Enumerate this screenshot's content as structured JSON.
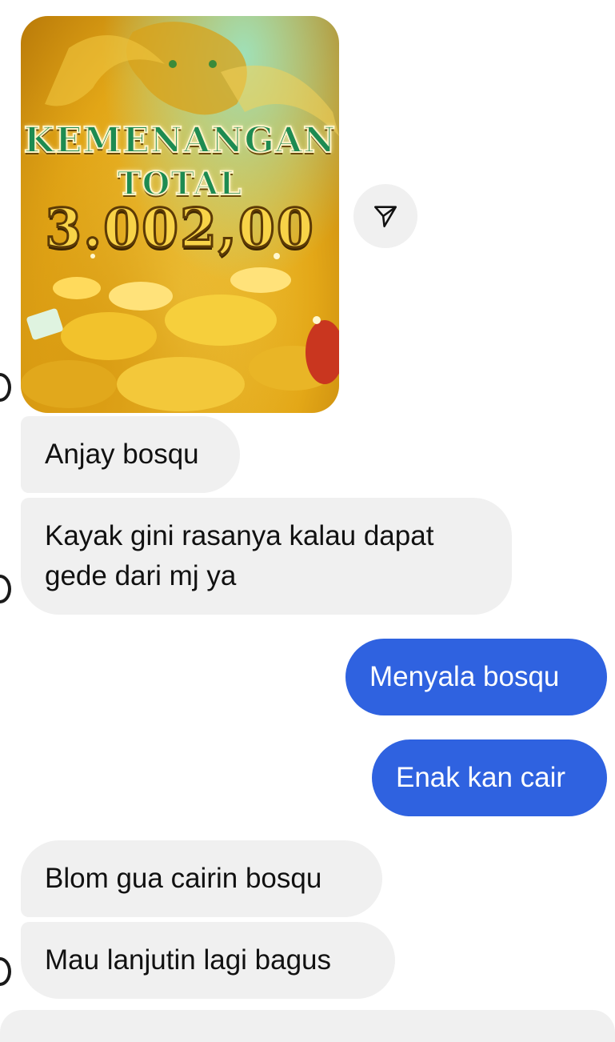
{
  "image_message": {
    "title_line1": "KEMENANGAN",
    "title_line2": "TOTAL",
    "amount": "3.002,00"
  },
  "share": {
    "icon": "send-icon"
  },
  "messages": [
    {
      "direction": "incoming",
      "text": "Anjay bosqu"
    },
    {
      "direction": "incoming",
      "text": "Kayak gini rasanya kalau dapat gede dari mj ya"
    },
    {
      "direction": "outgoing",
      "text": "Menyala bosqu"
    },
    {
      "direction": "outgoing",
      "text": "Enak kan cair"
    },
    {
      "direction": "incoming",
      "text": "Blom gua cairin bosqu"
    },
    {
      "direction": "incoming",
      "text": "Mau lanjutin lagi bagus"
    }
  ],
  "colors": {
    "outgoing_bubble": "#2f62e0",
    "incoming_bubble": "#f0f0f0",
    "win_text": "#1e8b52",
    "amount_text": "#f8d348"
  }
}
